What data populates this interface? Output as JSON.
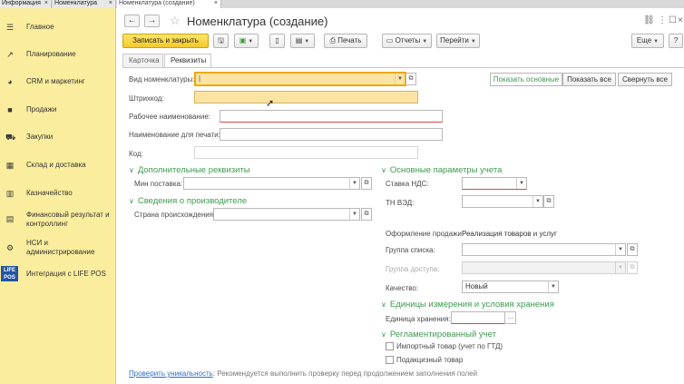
{
  "top_tabs": [
    {
      "label": "Информация",
      "active": false
    },
    {
      "label": "Номенклатура",
      "active": false
    },
    {
      "label": "Номенклатура (создание)",
      "active": true
    }
  ],
  "sidebar": {
    "items": [
      {
        "label": "Главное",
        "icon": "menu-icon"
      },
      {
        "label": "Планирование",
        "icon": "chart-icon"
      },
      {
        "label": "CRM и маркетинг",
        "icon": "pie-icon"
      },
      {
        "label": "Продажи",
        "icon": "bag-icon"
      },
      {
        "label": "Закупки",
        "icon": "cart-icon"
      },
      {
        "label": "Склад и доставка",
        "icon": "warehouse-icon"
      },
      {
        "label": "Казначейство",
        "icon": "bars-icon"
      },
      {
        "label": "Финансовый результат и контроллинг",
        "icon": "finance-icon"
      },
      {
        "label": "НСИ и администрирование",
        "icon": "gear-icon"
      },
      {
        "label": "Интеграция с LIFE POS",
        "icon": "lifepos-logo",
        "logo_text": "LIFE POS"
      }
    ]
  },
  "header": {
    "title": "Номенклатура (создание)",
    "back": "←",
    "forward": "→",
    "star": "☆",
    "link_icon": "🔗",
    "more_icon": "⋮",
    "max_icon": "☐",
    "close_icon": "×"
  },
  "toolbar": {
    "save_close": "Записать и закрыть",
    "print": "Печать",
    "reports": "Отчеты",
    "goto": "Перейти",
    "more": "Еще",
    "help": "?"
  },
  "form_tabs": [
    "Карточка",
    "Реквизиты"
  ],
  "view_buttons": [
    "Показать основные",
    "Показать все",
    "Свернуть все"
  ],
  "fields": {
    "vid_label": "Вид номенклатуры:",
    "vid_value": "",
    "barcode_label": "Штрихкод:",
    "work_name_label": "Рабочее наименование:",
    "print_name_label": "Наименование для печати:",
    "code_label": "Код:"
  },
  "sections": {
    "additional": "Дополнительные реквизиты",
    "min_supply_label": "Мин поставка:",
    "manufacturer": "Сведения о производителе",
    "country_label": "Страна происхождения:",
    "accounting": "Основные параметры учета",
    "vat_label": "Ставка НДС:",
    "tnved_label": "ТН ВЭД:",
    "sale_label": "Оформление продажи:",
    "sale_value": "Реализация товаров и услуг",
    "list_group_label": "Группа списка:",
    "access_group_label": "Группа доступа:",
    "quality_label": "Качество:",
    "quality_value": "Новый",
    "units": "Единицы измерения и условия хранения",
    "storage_unit_label": "Единица хранения:",
    "regulated": "Регламентированный учет",
    "import_label": "Импортный товар (учет по ГТД)",
    "excise_label": "Подакцизный товар"
  },
  "hint": {
    "link": "Проверить уникальность",
    "text": ": Рекомендуется выполнить проверку перед продолжением заполнения полей"
  },
  "colors": {
    "sidebar_bg": "#fbed9e",
    "accent_green": "#3f9a51",
    "primary_button": "#f5c928",
    "link": "#2d6ec5"
  }
}
